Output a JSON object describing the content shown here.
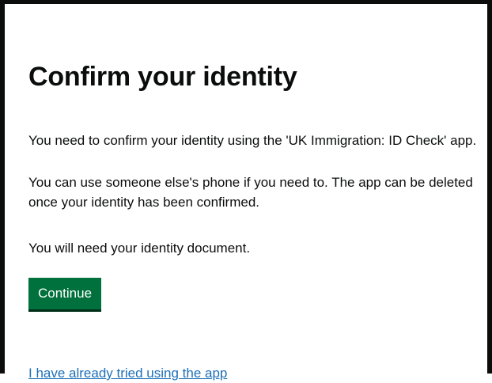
{
  "page": {
    "title": "Confirm your identity",
    "paragraphs": [
      "You need to confirm your identity using the 'UK Immigration: ID Check' app.",
      "You can use someone else's phone if you need to. The app can be deleted once your identity has been confirmed.",
      "You will need your identity document."
    ],
    "continue_label": "Continue",
    "already_tried_link": "I have already tried using the app"
  },
  "colors": {
    "button_green": "#00703c",
    "link_blue": "#1d70b8",
    "text": "#0b0c0c",
    "frame_border": "#0b0c0c"
  }
}
